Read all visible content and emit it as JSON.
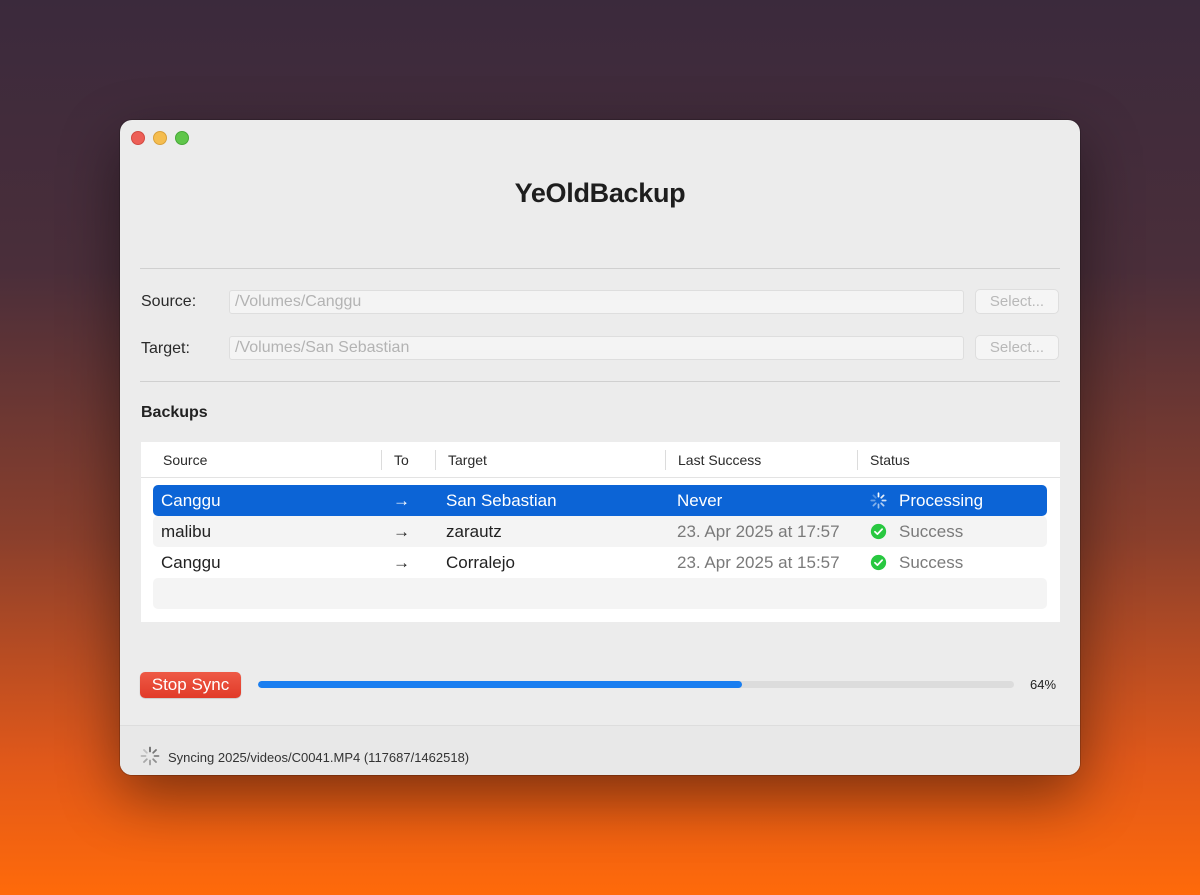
{
  "app": {
    "title": "YeOldBackup"
  },
  "source": {
    "label": "Source:",
    "value": "/Volumes/Canggu",
    "select_label": "Select..."
  },
  "target": {
    "label": "Target:",
    "value": "/Volumes/San Sebastian",
    "select_label": "Select..."
  },
  "backups": {
    "title": "Backups",
    "columns": [
      "Source",
      "To",
      "Target",
      "Last Success",
      "Status"
    ],
    "rows": [
      {
        "source": "Canggu",
        "arrow": "→",
        "target": "San Sebastian",
        "last_success": "Never",
        "status": "Processing",
        "status_icon": "spinner-icon",
        "selected": true
      },
      {
        "source": "malibu",
        "arrow": "→",
        "target": "zarautz",
        "last_success": "23. Apr 2025 at 17:57",
        "status": "Success",
        "status_icon": "check-circle-icon",
        "selected": false
      },
      {
        "source": "Canggu",
        "arrow": "→",
        "target": "Corralejo",
        "last_success": "23. Apr 2025 at 15:57",
        "status": "Success",
        "status_icon": "check-circle-icon",
        "selected": false
      }
    ]
  },
  "sync": {
    "stop_label": "Stop Sync",
    "progress_percent": 64,
    "progress_label": "64%",
    "status_text": "Syncing 2025/videos/C0041.MP4 (117687/1462518)"
  },
  "colors": {
    "accent": "#0c64d6",
    "progress": "#1a7ef0",
    "stop_button": "#e13a28",
    "success": "#28c840"
  }
}
